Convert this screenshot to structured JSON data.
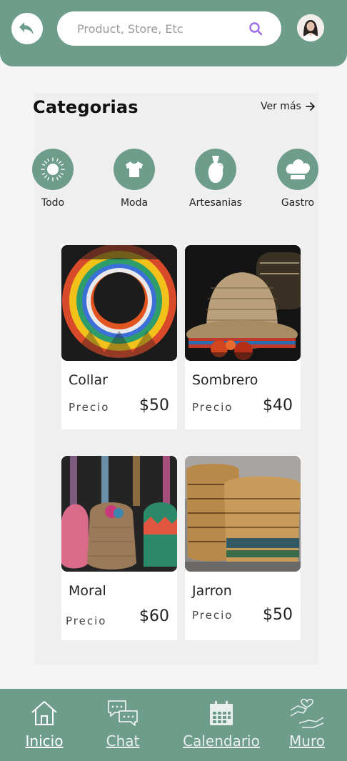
{
  "header": {
    "back_icon": "undo-arrow-icon",
    "search_placeholder": "Product, Store, Etc",
    "search_icon": "search-icon",
    "avatar": "user-avatar"
  },
  "categories": {
    "title": "Categorias",
    "see_more": "Ver más",
    "items": [
      {
        "label": "Todo",
        "icon": "sun-icon"
      },
      {
        "label": "Moda",
        "icon": "tshirt-icon"
      },
      {
        "label": "Artesanias",
        "icon": "vase-icon"
      },
      {
        "label": "Gastro",
        "icon": "chef-hat-icon"
      }
    ]
  },
  "products": [
    {
      "name": "Collar",
      "price_label": "Precio",
      "price": "$50"
    },
    {
      "name": "Sombrero",
      "price_label": "Precio",
      "price": "$40"
    },
    {
      "name": "Moral",
      "price_label": "Precio",
      "price": "$60"
    },
    {
      "name": "Jarron",
      "price_label": "Precio",
      "price": "$50"
    }
  ],
  "nav": {
    "items": [
      {
        "label": "Inicio",
        "icon": "home-icon",
        "active": true
      },
      {
        "label": "Chat",
        "icon": "chat-bubbles-icon",
        "active": false
      },
      {
        "label": "Calendario",
        "icon": "calendar-icon",
        "active": false
      },
      {
        "label": "Muro",
        "icon": "heart-hand-icon",
        "active": false
      }
    ]
  },
  "colors": {
    "brand": "#6f9d8c",
    "search_accent": "#9b6ee8"
  }
}
